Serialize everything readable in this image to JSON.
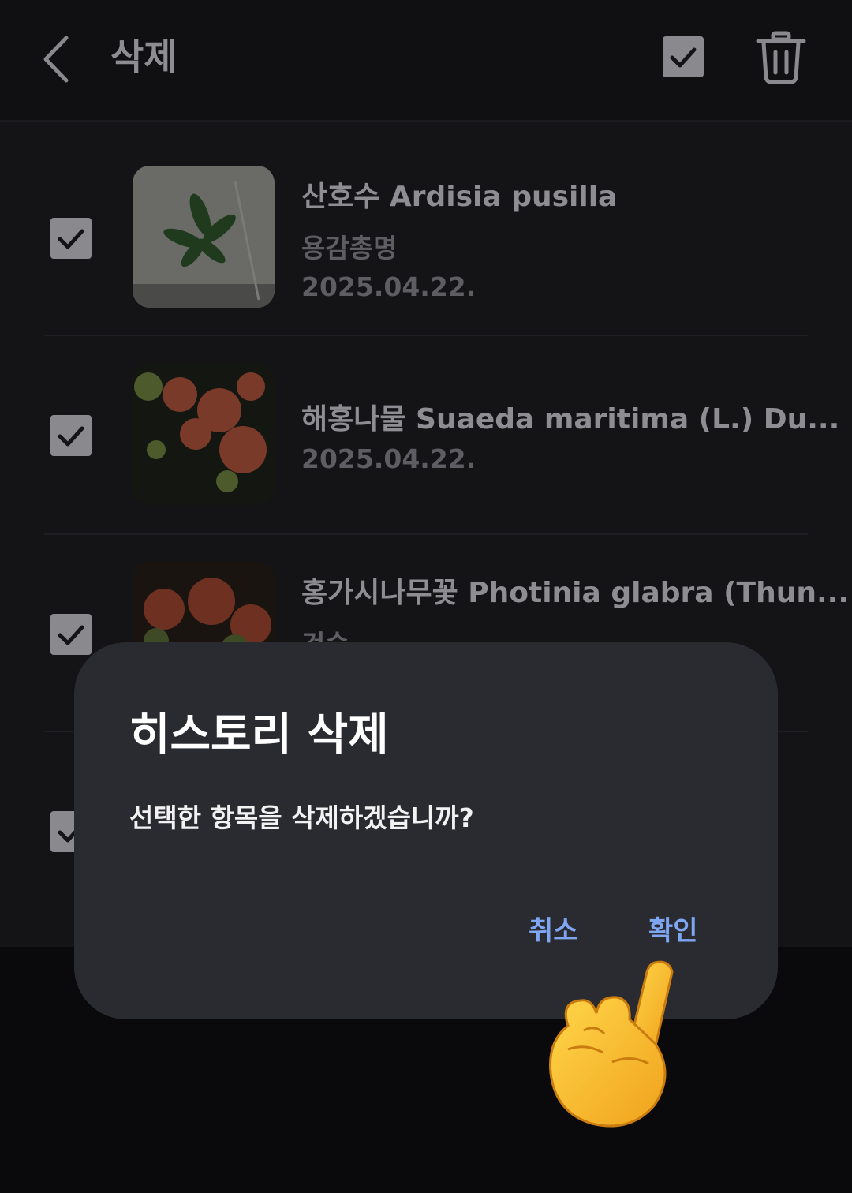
{
  "header": {
    "title": "삭제",
    "back_icon": "chevron-left-icon",
    "select_all_icon": "checkbox-checked-icon",
    "delete_icon": "trash-icon"
  },
  "items": [
    {
      "name": "산호수 Ardisia pusilla",
      "subtitle": "용감총명",
      "date": "2025.04.22.",
      "checked": true
    },
    {
      "name": "해홍나물 Suaeda maritima (L.) Du...",
      "subtitle": "",
      "date": "2025.04.22.",
      "checked": true
    },
    {
      "name": "홍가시나무꽃 Photinia glabra (Thun...",
      "subtitle": "건승",
      "date": "",
      "checked": true
    },
    {
      "name": "",
      "subtitle": "",
      "date": "",
      "checked": true
    }
  ],
  "dialog": {
    "title": "히스토리 삭제",
    "message": "선택한 항목을 삭제하겠습니까?",
    "cancel_label": "취소",
    "confirm_label": "확인"
  },
  "overlay": {
    "pointer_icon": "pointing-hand-icon"
  },
  "colors": {
    "accent": "#7ea6f2",
    "dialog_bg": "#2a2b30",
    "background": "#141417"
  }
}
